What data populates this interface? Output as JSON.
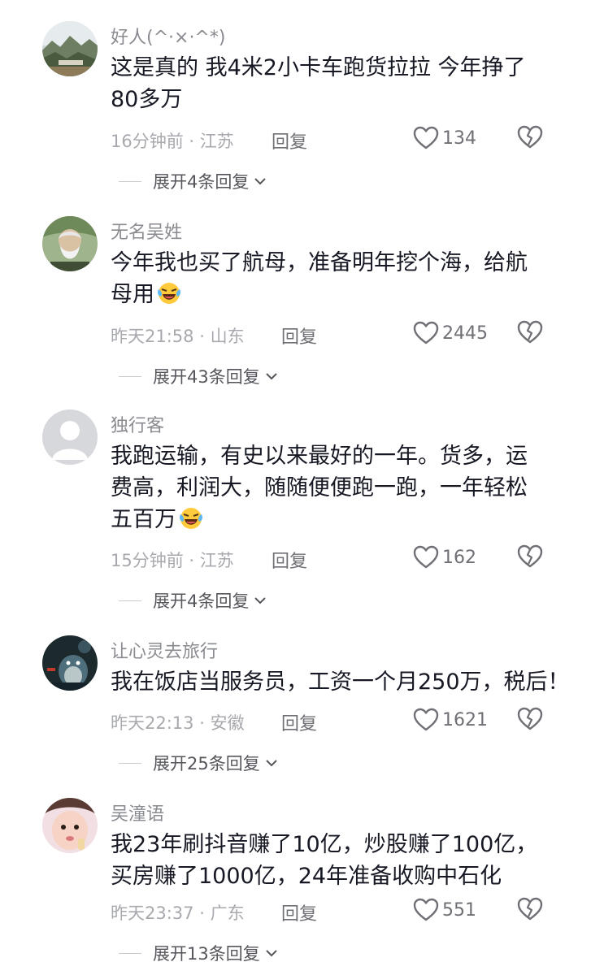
{
  "comments": [
    {
      "username": "好人(^·×·^*)",
      "text_lines": [
        "这是真的   我4米2小卡车跑货拉拉   今年挣了",
        "80多万"
      ],
      "time": "16分钟前",
      "location": "江苏",
      "reply_label": "回复",
      "likes": "134",
      "expand_label": "展开4条回复",
      "avatar": "landscape-avatar"
    },
    {
      "username": "无名吴姓",
      "text_lines": [
        "今年我也买了航母，准备明年挖个海，给航",
        "母用"
      ],
      "time": "昨天21:58",
      "location": "山东",
      "reply_label": "回复",
      "likes": "2445",
      "expand_label": "展开43条回复",
      "avatar": "old-man-avatar",
      "emoji": "laughing-crying-emoji"
    },
    {
      "username": "独行客",
      "text_lines": [
        "我跑运输，有史以来最好的一年。货多，运",
        "费高，利润大，随随便便跑一跑，一年轻松",
        "五百万"
      ],
      "time": "15分钟前",
      "location": "江苏",
      "reply_label": "回复",
      "likes": "162",
      "expand_label": "展开4条回复",
      "avatar": "default-avatar",
      "emoji": "laughing-crying-emoji"
    },
    {
      "username": "让心灵去旅行",
      "text_lines": [
        "我在饭店当服务员，工资一个月250万，税后！"
      ],
      "time": "昨天22:13",
      "location": "安徽",
      "reply_label": "回复",
      "likes": "1621",
      "expand_label": "展开25条回复",
      "avatar": "totoro-avatar"
    },
    {
      "username": "吴潼语",
      "text_lines": [
        "我23年刷抖音赚了10亿，炒股赚了100亿，",
        "买房赚了1000亿，24年准备收购中石化"
      ],
      "time": "昨天23:37",
      "location": "广东",
      "reply_label": "回复",
      "likes": "551",
      "expand_label": "展开13条回复",
      "avatar": "child-avatar"
    }
  ],
  "icons": {
    "like": "heart-outline-icon",
    "dislike": "broken-heart-icon",
    "expand": "chevron-down-icon"
  },
  "colors": {
    "text": "#161823",
    "username": "#8a8b91",
    "meta": "#a8a9ae",
    "icon": "#6f7075"
  }
}
